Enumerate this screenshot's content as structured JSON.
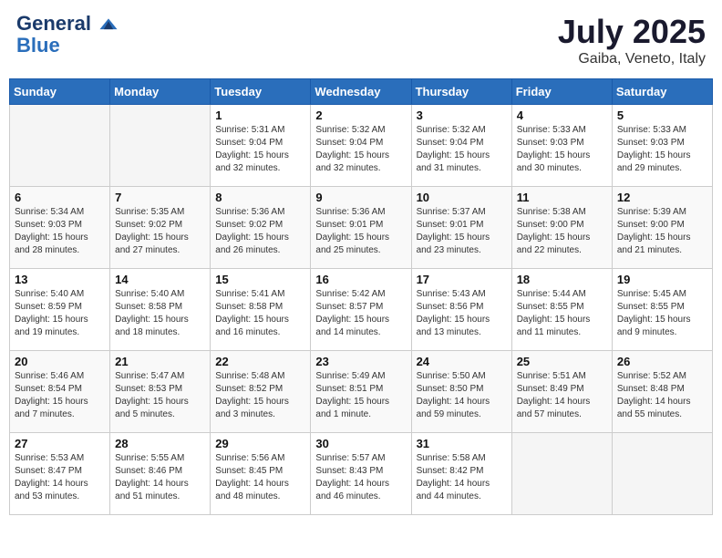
{
  "header": {
    "logo_line1": "General",
    "logo_line2": "Blue",
    "month": "July 2025",
    "location": "Gaiba, Veneto, Italy"
  },
  "weekdays": [
    "Sunday",
    "Monday",
    "Tuesday",
    "Wednesday",
    "Thursday",
    "Friday",
    "Saturday"
  ],
  "weeks": [
    [
      {
        "day": "",
        "empty": true
      },
      {
        "day": "",
        "empty": true
      },
      {
        "day": "1",
        "sunrise": "5:31 AM",
        "sunset": "9:04 PM",
        "daylight": "15 hours and 32 minutes."
      },
      {
        "day": "2",
        "sunrise": "5:32 AM",
        "sunset": "9:04 PM",
        "daylight": "15 hours and 32 minutes."
      },
      {
        "day": "3",
        "sunrise": "5:32 AM",
        "sunset": "9:04 PM",
        "daylight": "15 hours and 31 minutes."
      },
      {
        "day": "4",
        "sunrise": "5:33 AM",
        "sunset": "9:03 PM",
        "daylight": "15 hours and 30 minutes."
      },
      {
        "day": "5",
        "sunrise": "5:33 AM",
        "sunset": "9:03 PM",
        "daylight": "15 hours and 29 minutes."
      }
    ],
    [
      {
        "day": "6",
        "sunrise": "5:34 AM",
        "sunset": "9:03 PM",
        "daylight": "15 hours and 28 minutes."
      },
      {
        "day": "7",
        "sunrise": "5:35 AM",
        "sunset": "9:02 PM",
        "daylight": "15 hours and 27 minutes."
      },
      {
        "day": "8",
        "sunrise": "5:36 AM",
        "sunset": "9:02 PM",
        "daylight": "15 hours and 26 minutes."
      },
      {
        "day": "9",
        "sunrise": "5:36 AM",
        "sunset": "9:01 PM",
        "daylight": "15 hours and 25 minutes."
      },
      {
        "day": "10",
        "sunrise": "5:37 AM",
        "sunset": "9:01 PM",
        "daylight": "15 hours and 23 minutes."
      },
      {
        "day": "11",
        "sunrise": "5:38 AM",
        "sunset": "9:00 PM",
        "daylight": "15 hours and 22 minutes."
      },
      {
        "day": "12",
        "sunrise": "5:39 AM",
        "sunset": "9:00 PM",
        "daylight": "15 hours and 21 minutes."
      }
    ],
    [
      {
        "day": "13",
        "sunrise": "5:40 AM",
        "sunset": "8:59 PM",
        "daylight": "15 hours and 19 minutes."
      },
      {
        "day": "14",
        "sunrise": "5:40 AM",
        "sunset": "8:58 PM",
        "daylight": "15 hours and 18 minutes."
      },
      {
        "day": "15",
        "sunrise": "5:41 AM",
        "sunset": "8:58 PM",
        "daylight": "15 hours and 16 minutes."
      },
      {
        "day": "16",
        "sunrise": "5:42 AM",
        "sunset": "8:57 PM",
        "daylight": "15 hours and 14 minutes."
      },
      {
        "day": "17",
        "sunrise": "5:43 AM",
        "sunset": "8:56 PM",
        "daylight": "15 hours and 13 minutes."
      },
      {
        "day": "18",
        "sunrise": "5:44 AM",
        "sunset": "8:55 PM",
        "daylight": "15 hours and 11 minutes."
      },
      {
        "day": "19",
        "sunrise": "5:45 AM",
        "sunset": "8:55 PM",
        "daylight": "15 hours and 9 minutes."
      }
    ],
    [
      {
        "day": "20",
        "sunrise": "5:46 AM",
        "sunset": "8:54 PM",
        "daylight": "15 hours and 7 minutes."
      },
      {
        "day": "21",
        "sunrise": "5:47 AM",
        "sunset": "8:53 PM",
        "daylight": "15 hours and 5 minutes."
      },
      {
        "day": "22",
        "sunrise": "5:48 AM",
        "sunset": "8:52 PM",
        "daylight": "15 hours and 3 minutes."
      },
      {
        "day": "23",
        "sunrise": "5:49 AM",
        "sunset": "8:51 PM",
        "daylight": "15 hours and 1 minute."
      },
      {
        "day": "24",
        "sunrise": "5:50 AM",
        "sunset": "8:50 PM",
        "daylight": "14 hours and 59 minutes."
      },
      {
        "day": "25",
        "sunrise": "5:51 AM",
        "sunset": "8:49 PM",
        "daylight": "14 hours and 57 minutes."
      },
      {
        "day": "26",
        "sunrise": "5:52 AM",
        "sunset": "8:48 PM",
        "daylight": "14 hours and 55 minutes."
      }
    ],
    [
      {
        "day": "27",
        "sunrise": "5:53 AM",
        "sunset": "8:47 PM",
        "daylight": "14 hours and 53 minutes."
      },
      {
        "day": "28",
        "sunrise": "5:55 AM",
        "sunset": "8:46 PM",
        "daylight": "14 hours and 51 minutes."
      },
      {
        "day": "29",
        "sunrise": "5:56 AM",
        "sunset": "8:45 PM",
        "daylight": "14 hours and 48 minutes."
      },
      {
        "day": "30",
        "sunrise": "5:57 AM",
        "sunset": "8:43 PM",
        "daylight": "14 hours and 46 minutes."
      },
      {
        "day": "31",
        "sunrise": "5:58 AM",
        "sunset": "8:42 PM",
        "daylight": "14 hours and 44 minutes."
      },
      {
        "day": "",
        "empty": true
      },
      {
        "day": "",
        "empty": true
      }
    ]
  ]
}
